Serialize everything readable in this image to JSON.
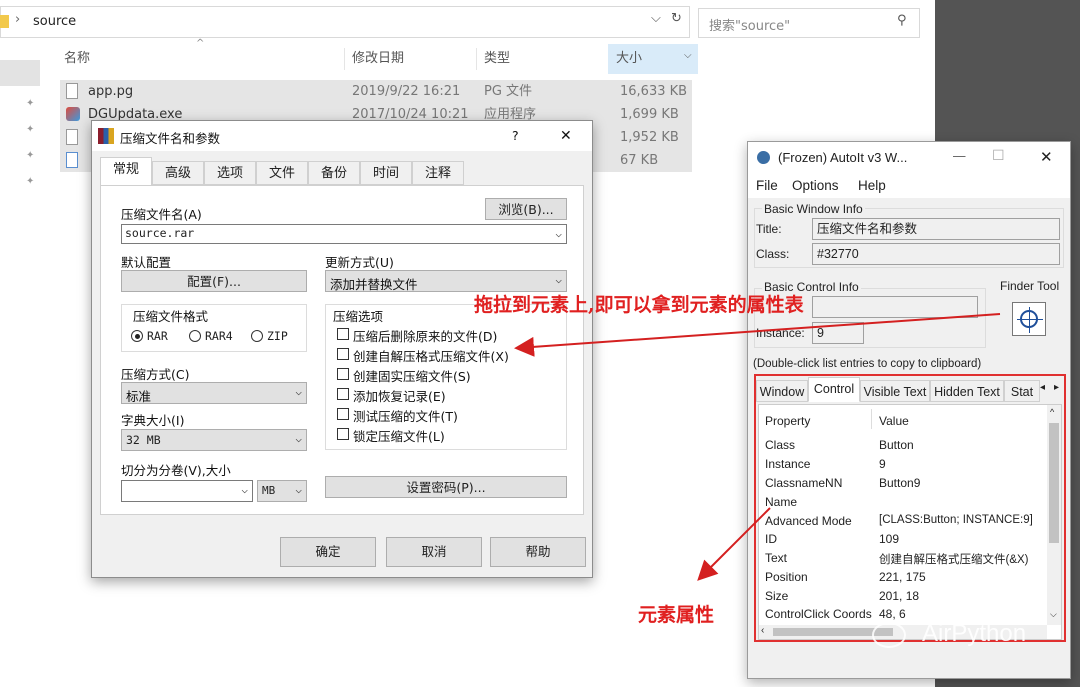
{
  "explorer": {
    "path_chevron": "›",
    "path": "source",
    "search_placeholder": "搜索\"source\"",
    "columns": {
      "name": "名称",
      "date": "修改日期",
      "type": "类型",
      "size": "大小"
    },
    "files": [
      {
        "name": "app.pg",
        "date": "2019/9/22 16:21",
        "type": "PG 文件",
        "size": "16,633 KB"
      },
      {
        "name": "DGUpdata.exe",
        "date": "2017/10/24 10:21",
        "type": "应用程序",
        "size": "1,699 KB"
      },
      {
        "name": "",
        "date": "",
        "type": "",
        "size": "1,952 KB"
      },
      {
        "name": "",
        "date": "",
        "type": "",
        "size": "67 KB"
      }
    ]
  },
  "rar": {
    "title": "压缩文件名和参数",
    "help_q": "?",
    "close": "✕",
    "tabs": [
      "常规",
      "高级",
      "选项",
      "文件",
      "备份",
      "时间",
      "注释"
    ],
    "archive_name_label": "压缩文件名(A)",
    "browse_button": "浏览(B)...",
    "archive_name_value": "source.rar",
    "default_profile_label": "默认配置",
    "profile_button": "配置(F)...",
    "update_mode_label": "更新方式(U)",
    "update_mode_value": "添加并替换文件",
    "format_group": "压缩文件格式",
    "formats": [
      "RAR",
      "RAR4",
      "ZIP"
    ],
    "options_group": "压缩选项",
    "options": [
      "压缩后删除原来的文件(D)",
      "创建自解压格式压缩文件(X)",
      "创建固实压缩文件(S)",
      "添加恢复记录(E)",
      "测试压缩的文件(T)",
      "锁定压缩文件(L)"
    ],
    "method_label": "压缩方式(C)",
    "method_value": "标准",
    "dict_label": "字典大小(I)",
    "dict_value": "32 MB",
    "split_label": "切分为分卷(V),大小",
    "split_unit": "MB",
    "password_button": "设置密码(P)...",
    "ok": "确定",
    "cancel": "取消",
    "help": "帮助"
  },
  "autoit": {
    "title": "(Frozen) AutoIt v3 W...",
    "minimize": "—",
    "maximize": "☐",
    "close": "✕",
    "menu": [
      "File",
      "Options",
      "Help"
    ],
    "basic_window_info": "Basic Window Info",
    "title_label": "Title:",
    "title_value": "压缩文件名和参数",
    "class_label": "Class:",
    "class_value": "#32770",
    "basic_control_info": "Basic Control Info",
    "instance_label": "Instance:",
    "instance_value": "9",
    "finder_tool": "Finder Tool",
    "hint": "(Double-click list entries to copy to clipboard)",
    "tabs": [
      "Window",
      "Control",
      "Visible Text",
      "Hidden Text",
      "Stat"
    ],
    "prop_header": "Property",
    "value_header": "Value",
    "properties": [
      {
        "name": "Class",
        "value": "Button"
      },
      {
        "name": "Instance",
        "value": "9"
      },
      {
        "name": "ClassnameNN",
        "value": "Button9"
      },
      {
        "name": "Name",
        "value": ""
      },
      {
        "name": "Advanced Mode",
        "value": "[CLASS:Button; INSTANCE:9]"
      },
      {
        "name": "ID",
        "value": "109"
      },
      {
        "name": "Text",
        "value": "创建自解压格式压缩文件(&X)"
      },
      {
        "name": "Position",
        "value": "221, 175"
      },
      {
        "name": "Size",
        "value": "201, 18"
      },
      {
        "name": "ControlClick Coords",
        "value": "48, 6"
      }
    ]
  },
  "annotations": {
    "drag_hint": "拖拉到元素上,即可以拿到元素的属性表",
    "element_props": "元素属性",
    "watermark": "AirPython"
  },
  "colors": {
    "annotation_red": "#e02020",
    "selection_blue": "#cde6f7"
  }
}
